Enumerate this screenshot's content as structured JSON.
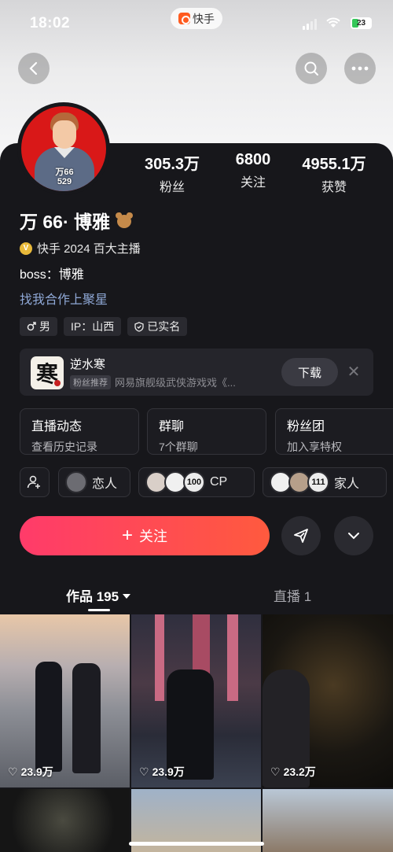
{
  "status_bar": {
    "time": "18:02",
    "battery": "23"
  },
  "app_pill": {
    "label": "快手"
  },
  "profile": {
    "avatar_label_1": "万66",
    "avatar_label_2": "529",
    "stats": [
      {
        "num": "305.3万",
        "label": "粉丝"
      },
      {
        "num": "6800",
        "label": "关注"
      },
      {
        "num": "4955.1万",
        "label": "获赞"
      }
    ],
    "name": "万 66· 博雅",
    "verify_text": "快手 2024 百大主播",
    "bio": "boss：博雅",
    "business": "找我合作上聚星",
    "chips": [
      "男",
      "IP：山西",
      "已实名"
    ]
  },
  "promo": {
    "game_glyph": "寒",
    "title": "逆水寒",
    "badge": "粉丝推荐",
    "desc": "网易旗舰级武侠游戏戏《...",
    "download": "下载"
  },
  "cards": [
    {
      "title": "直播动态",
      "sub": "查看历史记录"
    },
    {
      "title": "群聊",
      "sub": "7个群聊"
    },
    {
      "title": "粉丝团",
      "sub": "加入享特权"
    }
  ],
  "relations": {
    "lover": "恋人",
    "cp_count": "100",
    "cp": "CP",
    "family_count": "111",
    "family": "家人"
  },
  "actions": {
    "follow": "关注"
  },
  "tabs": {
    "works": "作品 195",
    "live": "直播 1"
  },
  "grid": [
    {
      "likes": "23.9万"
    },
    {
      "likes": "23.9万"
    },
    {
      "likes": "23.2万"
    }
  ],
  "colors": {
    "follow_start": "#ff3b6a",
    "follow_end": "#ff5a3e",
    "panel": "#17171b",
    "link": "#8fa8d6"
  }
}
